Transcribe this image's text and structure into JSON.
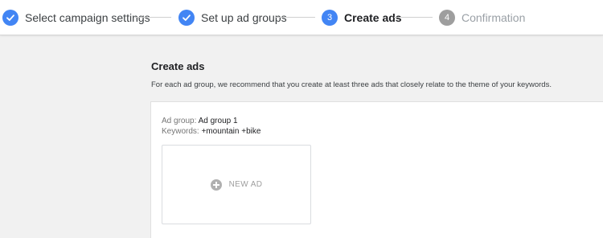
{
  "stepper": {
    "steps": [
      {
        "number": "",
        "label": "Select campaign settings",
        "state": "done"
      },
      {
        "number": "",
        "label": "Set up ad groups",
        "state": "done"
      },
      {
        "number": "3",
        "label": "Create ads",
        "state": "active"
      },
      {
        "number": "4",
        "label": "Confirmation",
        "state": "pending"
      }
    ]
  },
  "main": {
    "title": "Create ads",
    "description": "For each ad group, we recommend that you create at least three ads that closely relate to the theme of your keywords."
  },
  "ad_group": {
    "label": "Ad group:",
    "name": "Ad group 1",
    "keywords_label": "Keywords:",
    "keywords": "+mountain +bike",
    "new_ad_label": "NEW AD"
  },
  "colors": {
    "accent": "#4285f4",
    "pending": "#9e9e9e"
  }
}
